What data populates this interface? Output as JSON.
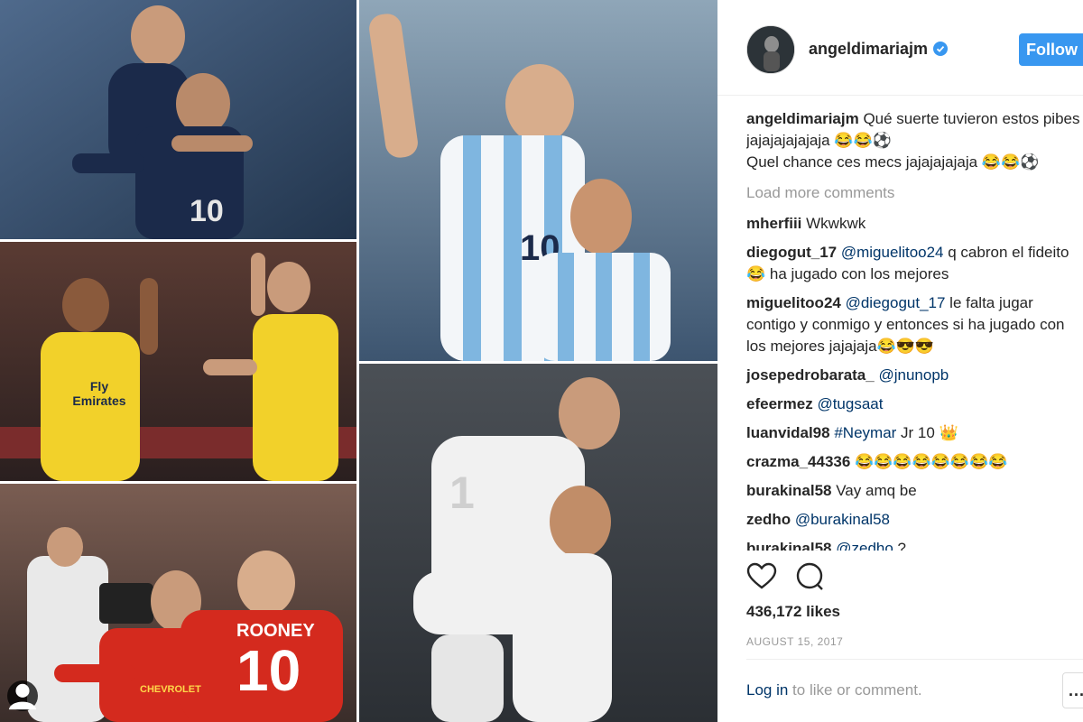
{
  "post": {
    "username": "angeldimariajm",
    "follow_label": "Follow",
    "caption_line1": "Qué suerte tuvieron estos pibes jajajajajajaja 😂😂⚽",
    "caption_line2": "Quel chance ces mecs jajajajajaja 😂😂⚽",
    "load_more": "Load more comments",
    "likes": "436,172 likes",
    "date": "AUGUST 15, 2017",
    "login_link": "Log in",
    "login_rest": " to like or comment.",
    "more_label": "..."
  },
  "comments": [
    {
      "user": "mherfiii",
      "mention": "",
      "text": "Wkwkwk"
    },
    {
      "user": "diegogut_17",
      "mention": "@miguelitoo24",
      "text": " q cabron el fideito 😂 ha jugado con los mejores"
    },
    {
      "user": "miguelitoo24",
      "mention": "@diegogut_17",
      "text": " le falta jugar contigo y conmigo y entonces si ha jugado con los mejores jajajaja😂😎😎"
    },
    {
      "user": "josepedrobarata_",
      "mention": "@jnunopb",
      "text": ""
    },
    {
      "user": "efeermez",
      "mention": "@tugsaat",
      "text": ""
    },
    {
      "user": "luanvidal98",
      "mention": "#Neymar",
      "text": " Jr 10 👑"
    },
    {
      "user": "crazma_44336",
      "mention": "",
      "text": "😂😂😂😂😂😂😂😂"
    },
    {
      "user": "burakinal58",
      "mention": "",
      "text": "Vay amq be"
    },
    {
      "user": "zedho",
      "mention": "@burakinal58",
      "text": ""
    },
    {
      "user": "burakinal58",
      "mention": "@zedho",
      "text": " ?"
    }
  ],
  "photo_text": {
    "shirt_name": "ROONEY",
    "shirt_number": "10",
    "sponsor_1": "Fly Emirates",
    "sponsor_2": "CHEVROLET"
  },
  "colors": {
    "follow_bg": "#3897f0",
    "mention": "#003569",
    "muted": "#999999",
    "psg_navy": "#1b2a4a",
    "psg_yellow": "#f2d12a",
    "argentina_blue": "#7fb6e0",
    "man_utd_red": "#d42a1e",
    "real_white": "#f1f1f1"
  },
  "icons": [
    "verified-badge-icon",
    "heart-icon",
    "comment-icon",
    "tagged-user-icon"
  ]
}
